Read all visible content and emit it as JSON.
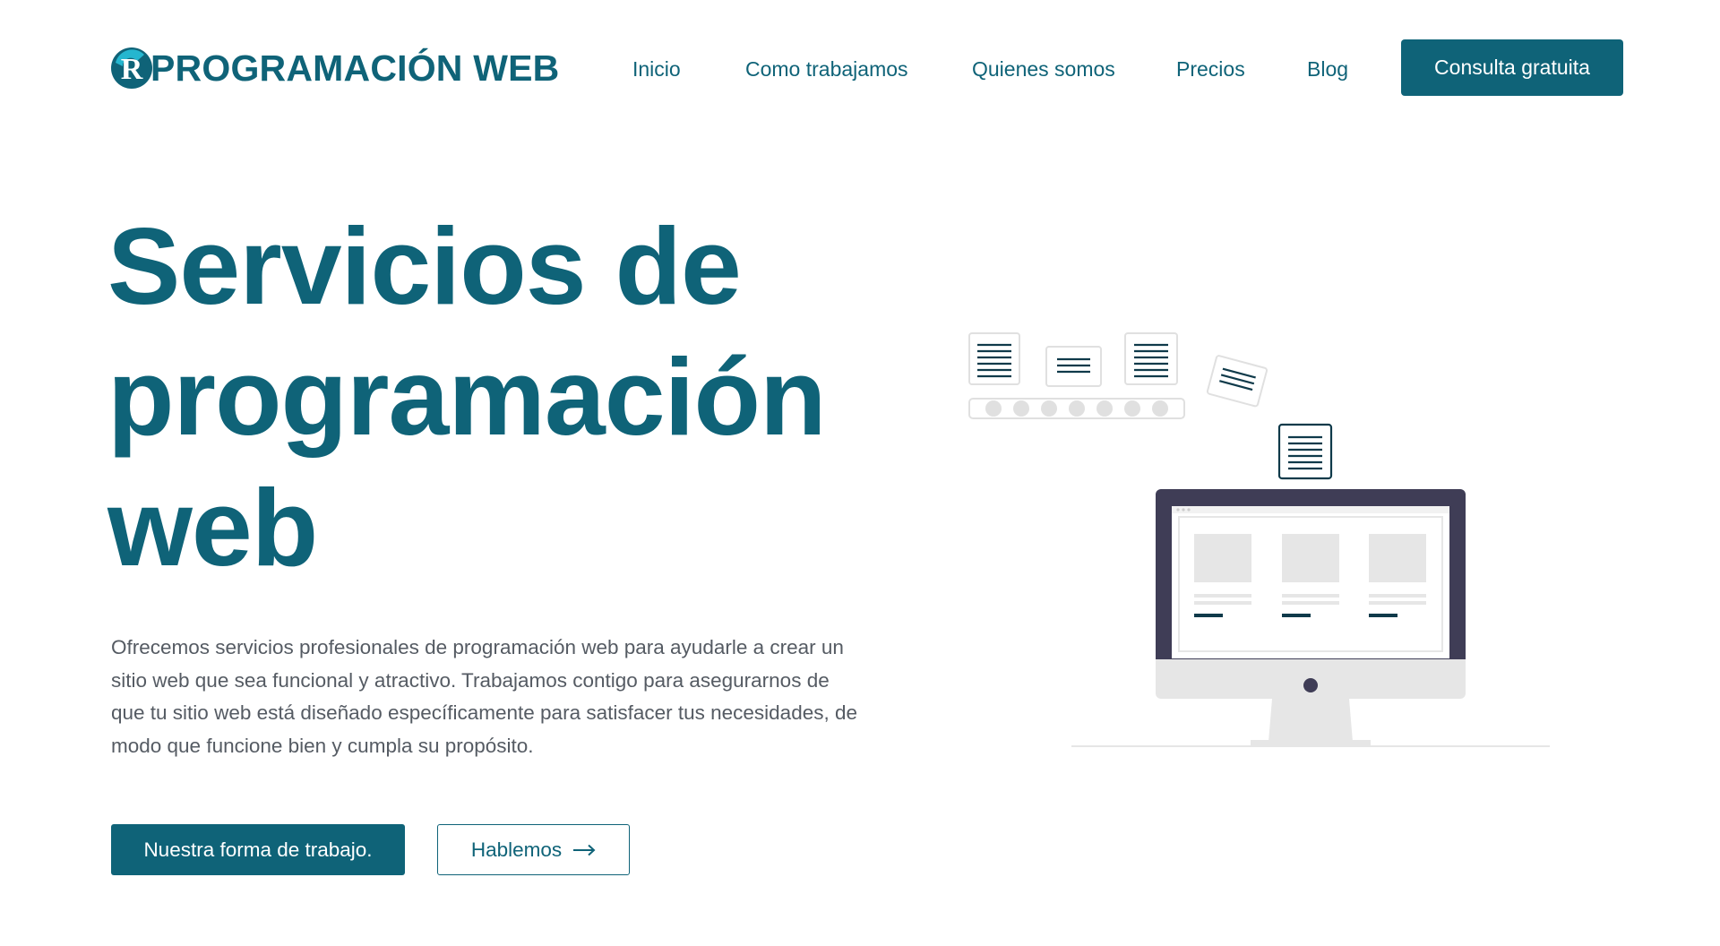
{
  "header": {
    "logo_text": "PROGRAMACIÓN WEB",
    "logo_icon": "r-logo-icon",
    "nav": [
      {
        "label": "Inicio"
      },
      {
        "label": "Como trabajamos"
      },
      {
        "label": "Quienes somos"
      },
      {
        "label": "Precios"
      },
      {
        "label": "Blog"
      }
    ],
    "cta_label": "Consulta gratuita"
  },
  "hero": {
    "title_lines": [
      "Servicios de",
      "programación",
      "web"
    ],
    "description": "Ofrecemos servicios profesionales de programación web para ayudarle a crear un sitio web que sea funcional y atractivo. Trabajamos contigo para asegurarnos de que tu sitio web está diseñado específicamente para satisfacer tus necesidades, de modo que funcione bien y cumpla su propósito.",
    "primary_button": "Nuestra forma de trabajo.",
    "secondary_button": "Hablemos",
    "secondary_button_icon": "arrow-right-icon"
  },
  "illustration": {
    "name": "web-development-illustration"
  },
  "colors": {
    "brand": "#0f6378",
    "text_body": "#555b63",
    "monitor_frame": "#3f3d56",
    "placeholder_gray": "#e6e6e6"
  }
}
